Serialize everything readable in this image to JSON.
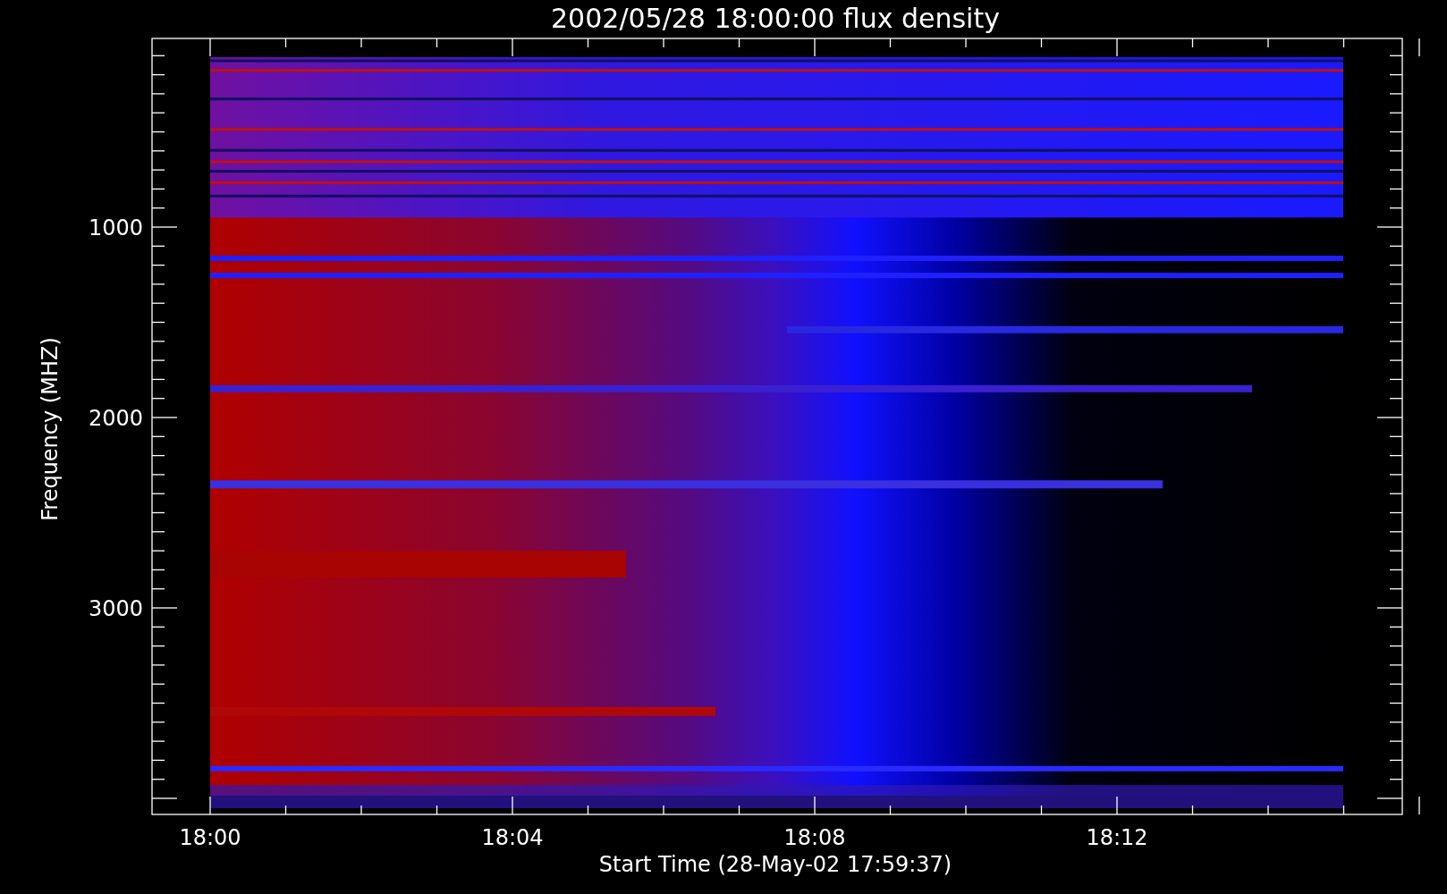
{
  "title": "2002/05/28 18:00:00 flux density",
  "x_axis": {
    "label": "Start Time (28-May-02 17:59:37)",
    "ticks": [
      "18:00",
      "18:04",
      "18:08",
      "18:12"
    ]
  },
  "y_axis": {
    "label": "Frequency (MHZ)",
    "ticks": [
      "1000",
      "2000",
      "3000"
    ]
  }
}
